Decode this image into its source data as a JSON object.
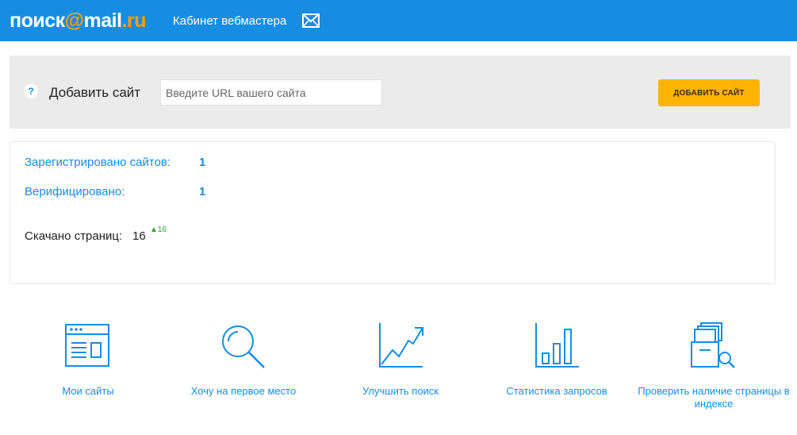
{
  "header": {
    "logo_left": "поиск",
    "logo_at": "@",
    "logo_mail": "mail",
    "logo_ru": ".ru",
    "cabinet": "Кабинет вебмастера",
    "mail_icon": "envelope-icon"
  },
  "add_site": {
    "help": "?",
    "label": "Добавить сайт",
    "placeholder": "Введите URL вашего сайта",
    "value": "",
    "button": "ДОБАВИТЬ САЙТ"
  },
  "stats": {
    "registered_label": "Зарегистрировано сайтов:",
    "registered_value": "1",
    "verified_label": "Верифицировано:",
    "verified_value": "1",
    "pages_label": "Скачано страниц:",
    "pages_value": "16",
    "pages_delta": "▲16"
  },
  "tiles": [
    {
      "label": "Мои сайты",
      "icon": "browser-window-icon"
    },
    {
      "label": "Хочу на первое место",
      "icon": "magnifier-icon"
    },
    {
      "label": "Улучшить поиск",
      "icon": "trend-chart-icon"
    },
    {
      "label": "Статистика запросов",
      "icon": "bar-stats-icon"
    },
    {
      "label": "Проверить наличие страницы в индексе",
      "icon": "documents-search-icon"
    }
  ],
  "colors": {
    "header": "#168de2",
    "accent": "#168de2",
    "logo_orange": "#ff9e00",
    "button": "#ffb400",
    "panel": "#ebebeb",
    "delta_green": "#2aa52a"
  }
}
